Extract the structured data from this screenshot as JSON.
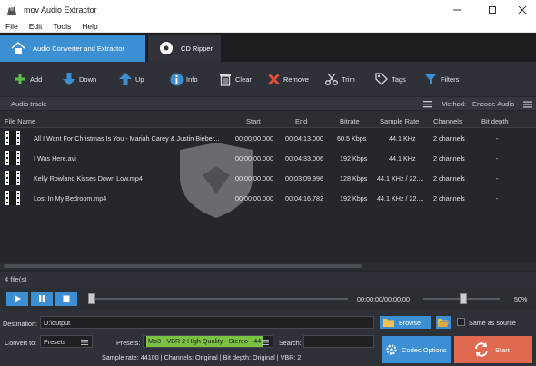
{
  "window": {
    "title": "mov Audio Extractor"
  },
  "menu": [
    "File",
    "Edit",
    "Tools",
    "Help"
  ],
  "tabs": [
    {
      "label": "Audio Converter and Extractor",
      "active": true
    },
    {
      "label": "CD Ripper",
      "active": false
    }
  ],
  "toolbar": {
    "add": "Add",
    "down": "Down",
    "up": "Up",
    "info": "Info",
    "clear": "Clear",
    "remove": "Remove",
    "trim": "Trim",
    "tags": "Tags",
    "filters": "Filters"
  },
  "audio_track": {
    "label": "Audio track:",
    "method_label": "Method:",
    "method_value": "Encode Audio"
  },
  "columns": [
    "File Name",
    "Start",
    "End",
    "Bitrate",
    "Sample Rate",
    "Channels",
    "Bit depth"
  ],
  "files": [
    {
      "name": "All I Want For Christmas Is You - Mariah Carey & Justin Bieber...",
      "start": "00:00:00.000",
      "end": "00:04:13.000",
      "bitrate": "60.5 Kbps",
      "sample_rate": "44.1 KHz",
      "channels": "2 channels",
      "bit_depth": "-"
    },
    {
      "name": "I Was Here.avi",
      "start": "00:00:00.000",
      "end": "00:04:33.006",
      "bitrate": "192 Kbps",
      "sample_rate": "44.1 KHz",
      "channels": "2 channels",
      "bit_depth": "-"
    },
    {
      "name": "Kelly Rowland Kisses Down Low.mp4",
      "start": "00:00:00.000",
      "end": "00:03:09.996",
      "bitrate": "128 Kbps",
      "sample_rate": "44.1 KHz / 22....",
      "channels": "2 channels",
      "bit_depth": "-"
    },
    {
      "name": "Lost In My Bedroom.mp4",
      "start": "00:00:00.000",
      "end": "00:04:16.782",
      "bitrate": "192 Kbps",
      "sample_rate": "44.1 KHz / 22....",
      "channels": "2 channels",
      "bit_depth": "-"
    }
  ],
  "file_count": "4 file(s)",
  "player": {
    "time": "00:00:00/00:00:00",
    "volume": "50%",
    "seek_fraction": 0.0,
    "volume_fraction": 0.5
  },
  "destination": {
    "label": "Destination:",
    "value": "D:\\output",
    "browse_label": "Browse",
    "same_as_source_label": "Same as source"
  },
  "convert": {
    "label": "Convert to:",
    "value": "Presets",
    "presets_label": "Presets:",
    "presets_value": "Mp3 - VBR 2 High Quality - Stereo - 44",
    "search_label": "Search:",
    "search_value": ""
  },
  "codec_options_label": "Codec Options",
  "start_label": "Start",
  "status_line": "Sample rate: 44100 | Channels: Original | Bit depth: Original | VBR: 2",
  "colors": {
    "accent_blue": "#3d8fd4",
    "start_orange": "#e06a4f",
    "preset_green": "#7bc142",
    "background": "#2a2d33"
  }
}
